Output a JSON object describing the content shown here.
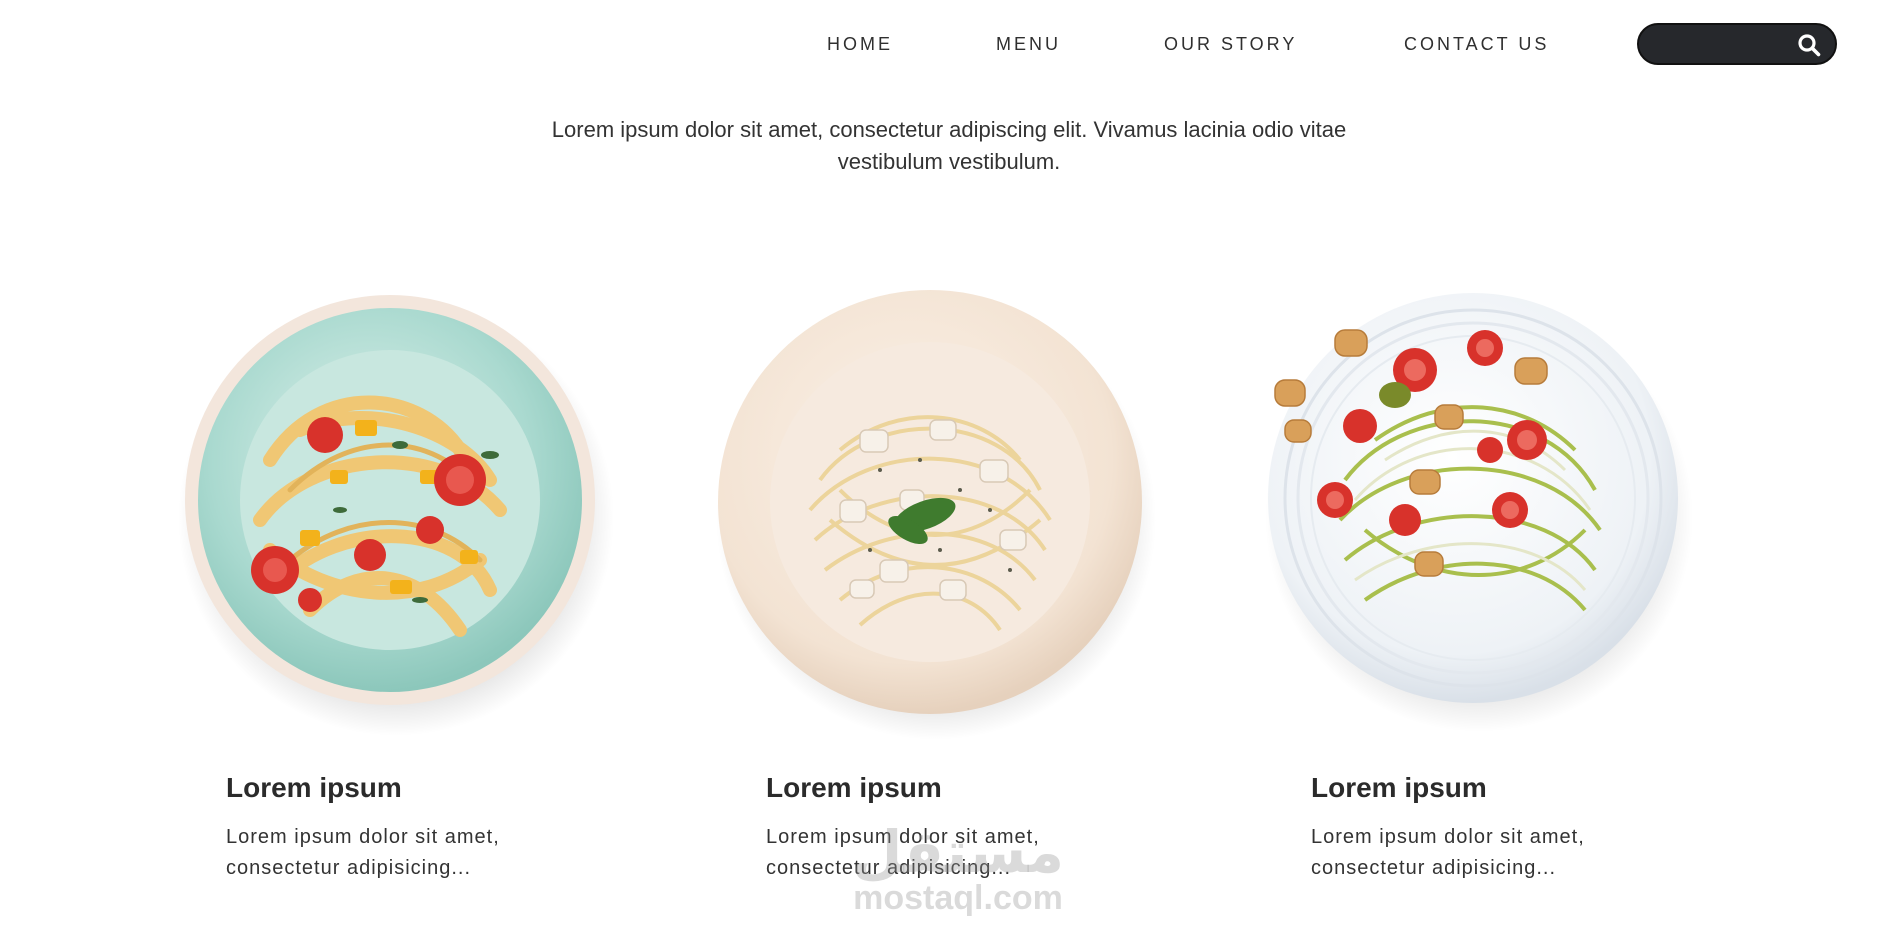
{
  "nav": {
    "items": [
      {
        "label": "HOME"
      },
      {
        "label": "MENU"
      },
      {
        "label": "OUR STORY"
      },
      {
        "label": "CONTACT US"
      }
    ],
    "search": {
      "value": "",
      "placeholder": "",
      "icon": "search-icon"
    }
  },
  "intro": {
    "text": "Lorem ipsum dolor sit amet, consectetur adipiscing elit. Vivamus lacinia odio vitae vestibulum vestibulum."
  },
  "cards": [
    {
      "title": "Lorem ipsum",
      "description": "Lorem ipsum dolor sit amet, consectetur adipisicing...",
      "plate_color": "#a9d9cf",
      "dish": "fettuccine with tomatoes and peppers"
    },
    {
      "title": "Lorem ipsum",
      "description": "Lorem ipsum dolor sit amet, consectetur adipisicing...",
      "plate_color": "#f3e3d3",
      "dish": "spaghetti with chicken and basil"
    },
    {
      "title": "Lorem ipsum",
      "description": "Lorem ipsum dolor sit amet, consectetur adipisicing...",
      "plate_color": "#eef2f6",
      "dish": "zucchini noodles with tomatoes and croutons"
    }
  ],
  "watermark": {
    "arabic": "مستقل",
    "latin": "mostaql.com"
  },
  "colors": {
    "search_bg": "#26282c",
    "text": "#2b2b2b",
    "background": "#ffffff"
  }
}
